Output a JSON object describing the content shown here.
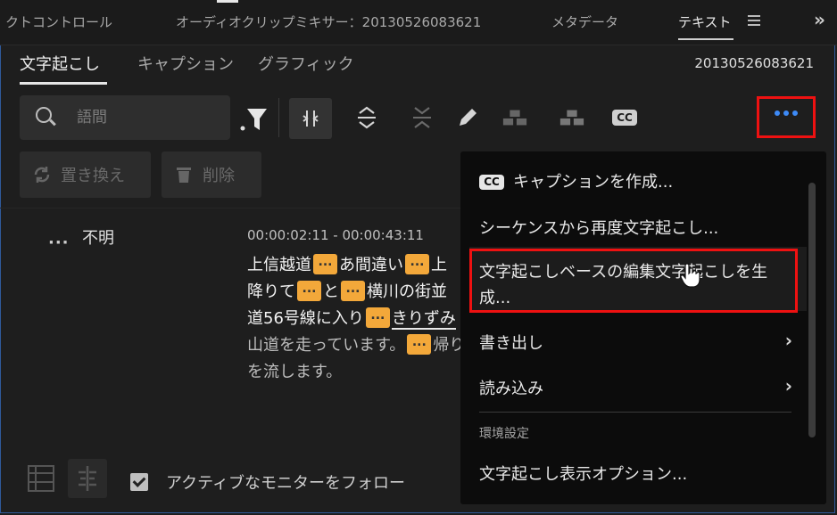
{
  "panel_tabs": [
    {
      "label": "クトコントロール"
    },
    {
      "label": "オーディオクリップミキサー：20130526083621"
    },
    {
      "label": "メタデータ"
    },
    {
      "label": "テキスト"
    }
  ],
  "subtabs": [
    {
      "label": "文字起こし"
    },
    {
      "label": "キャプション"
    },
    {
      "label": "グラフィック"
    }
  ],
  "sequence_id": "20130526083621",
  "search": {
    "placeholder": "語間"
  },
  "actions": {
    "replace": "置き換え",
    "delete": "削除"
  },
  "transcript": {
    "speaker": "不明",
    "timecode": "00:00:02:11 - 00:00:43:11",
    "line1_a": "上信越道",
    "line1_b": "あ間違い",
    "line1_c": "上",
    "line2_a": "降りて",
    "line2_b": "と",
    "line2_c": "横川の街並",
    "line3_a": "道56号線に入り",
    "line3_b": "きりずみ",
    "line4_a": "山道を走っています。",
    "line4_b": "帰り",
    "line5": "を流します。"
  },
  "footer": {
    "follow_label": "アクティブなモニターをフォロー",
    "follow_checked": true
  },
  "menu": {
    "items": [
      {
        "label": "キャプションを作成..."
      },
      {
        "label": "シーケンスから再度文字起こし..."
      },
      {
        "label": "文字起こしベースの編集文字起こしを生",
        "label2": "成..."
      },
      {
        "label": "書き出し"
      },
      {
        "label": "読み込み"
      }
    ],
    "section": "環境設定",
    "display_options": "文字起こし表示オプション..."
  },
  "icons": {
    "cc": "CC"
  },
  "colors": {
    "accent_blue": "#3d8af7",
    "gap_orange": "#f3a83a",
    "highlight_red": "#e11111"
  }
}
